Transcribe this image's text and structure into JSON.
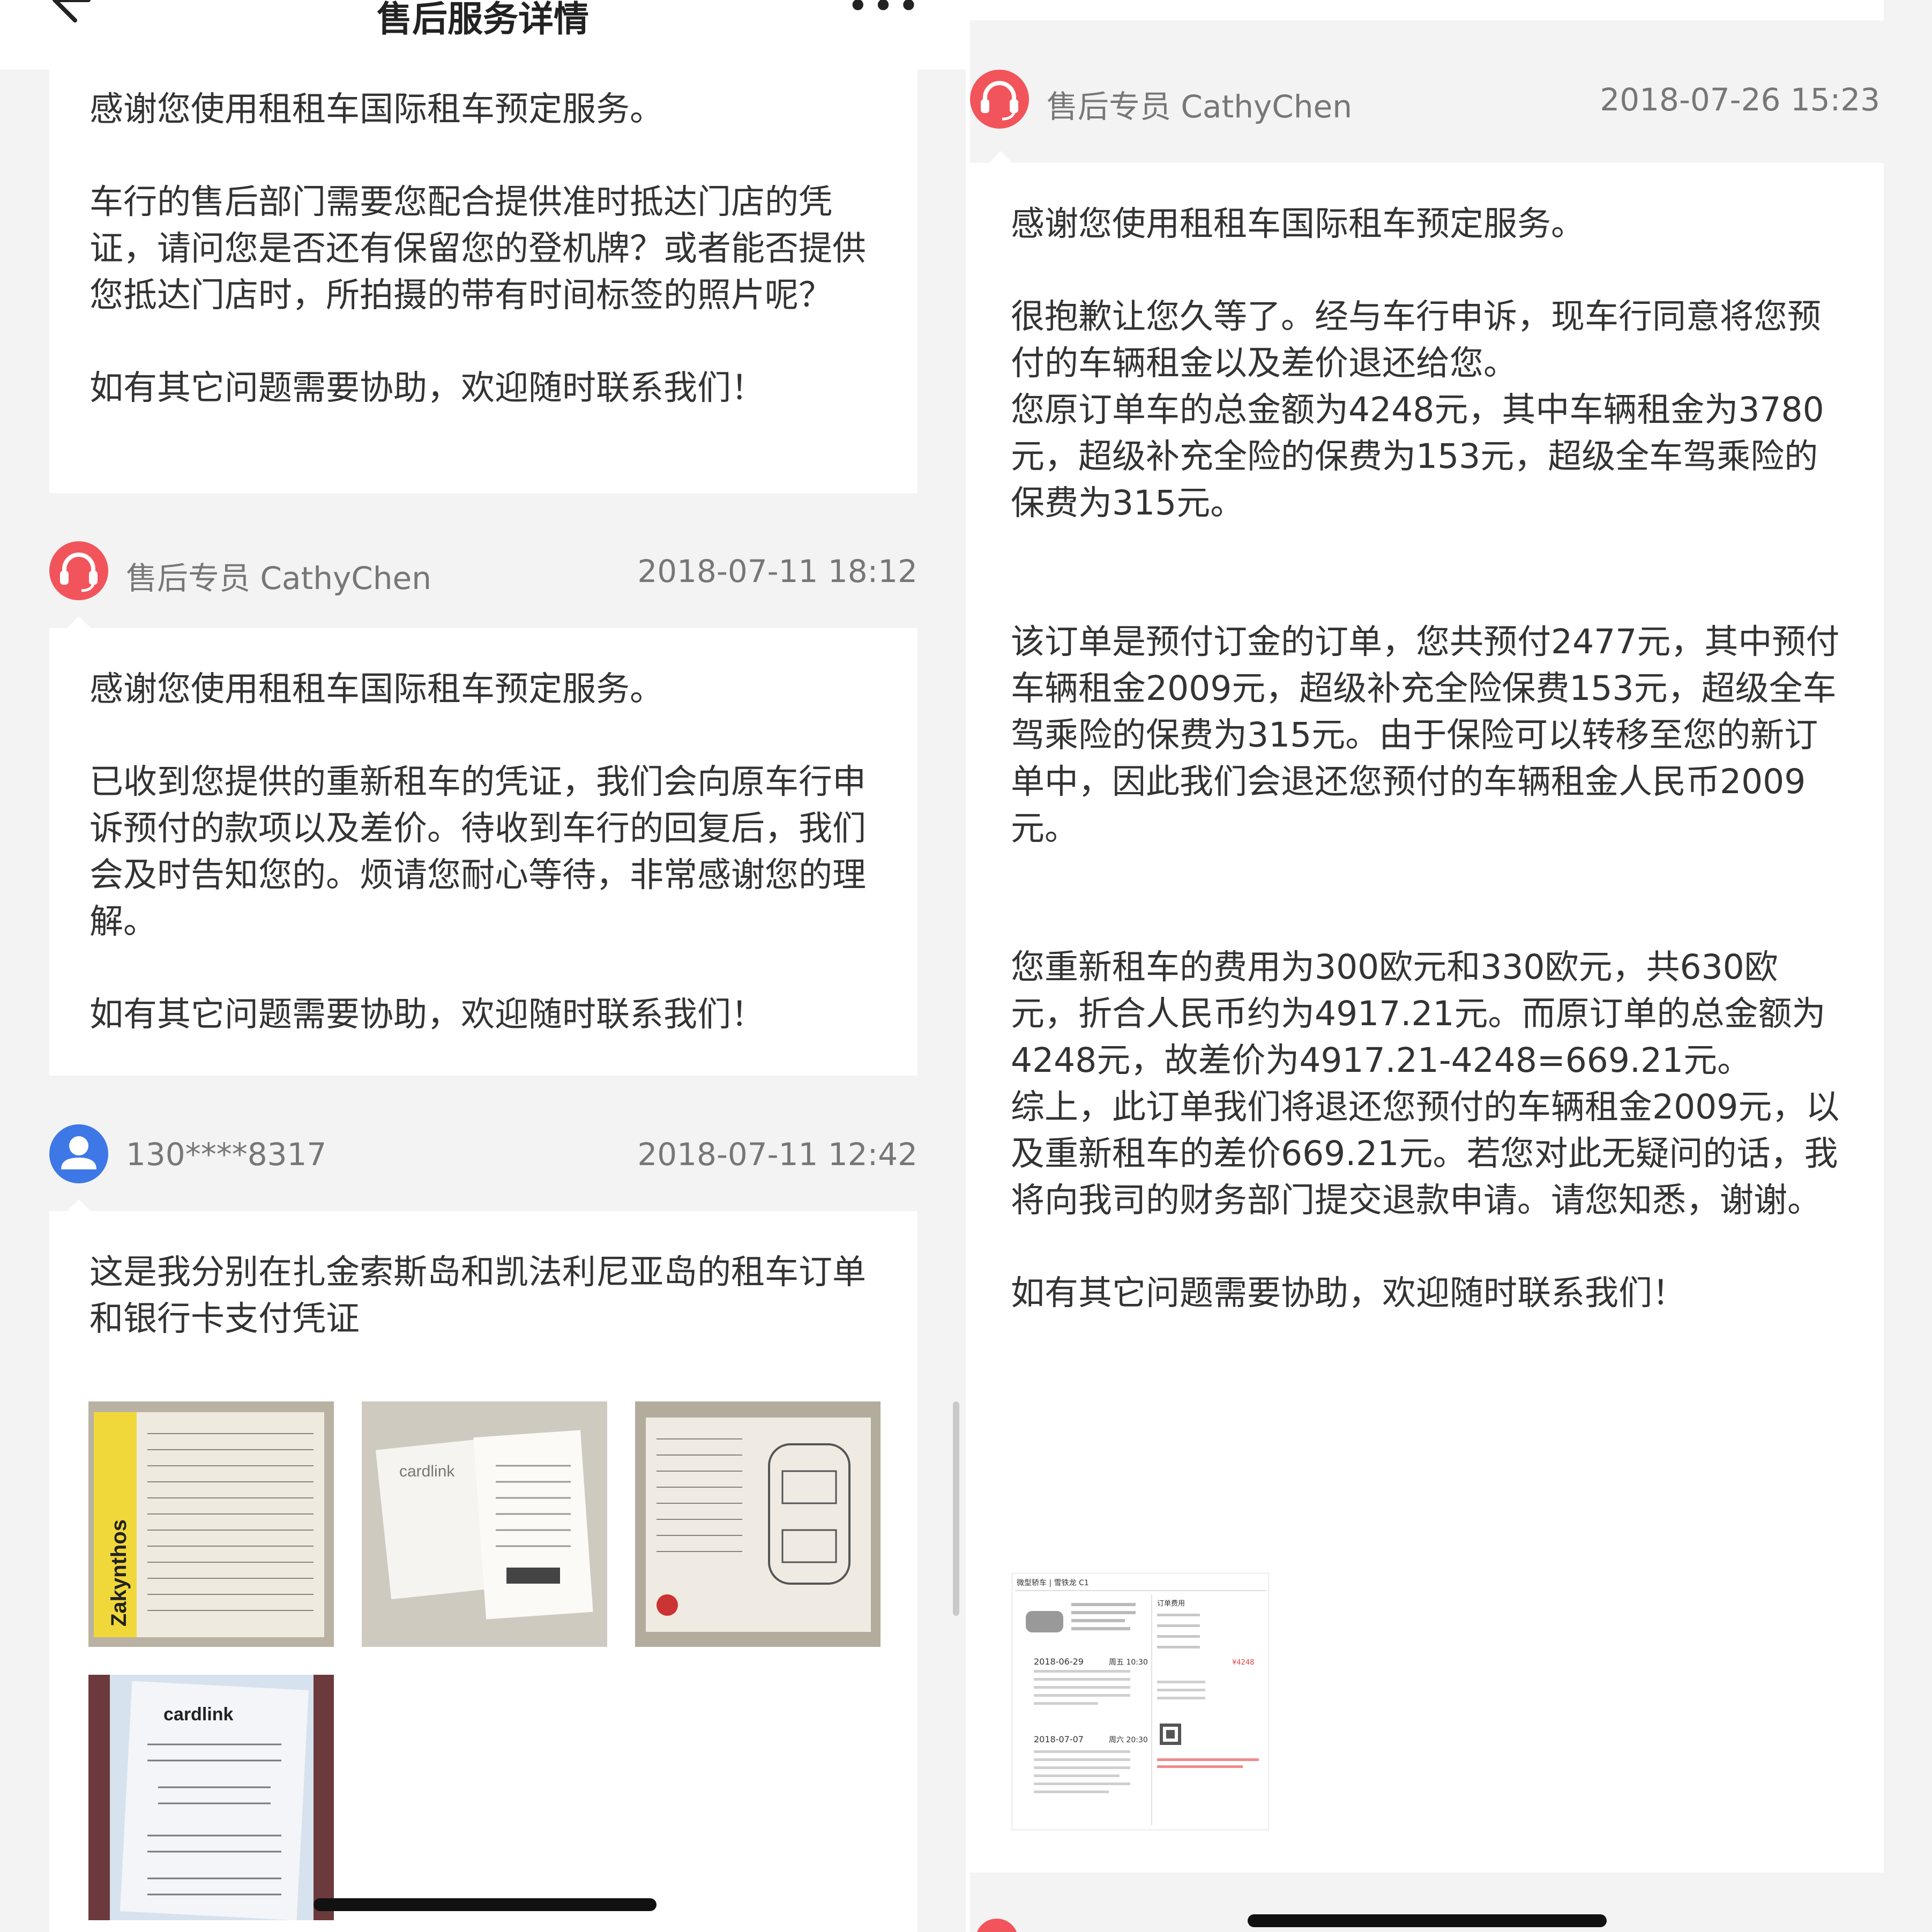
{
  "header": {
    "title": "售后服务详情"
  },
  "left": {
    "card1": {
      "paragraphs": [
        "感谢您使用租租车国际租车预定服务。",
        "车行的售后部门需要您配合提供准时抵达门店的凭证，请问您是否还有保留您的登机牌？或者能否提供您抵达门店时，所拍摄的带有时间标签的照片呢？",
        "如有其它问题需要协助，欢迎随时联系我们！"
      ]
    },
    "msg2": {
      "author": "售后专员 CathyChen",
      "time": "2018-07-11 18:12",
      "paragraphs": [
        "感谢您使用租租车国际租车预定服务。",
        "已收到您提供的重新租车的凭证，我们会向原车行申诉预付的款项以及差价。待收到车行的回复后，我们会及时告知您的。烦请您耐心等待，非常感谢您的理解。",
        "如有其它问题需要协助，欢迎随时联系我们！"
      ]
    },
    "msg3": {
      "author": "130****8317",
      "time": "2018-07-11 12:42",
      "text": "这是我分别在扎金索斯岛和凯法利尼亚岛的租车订单和银行卡支付凭证",
      "photos": [
        {
          "name": "zakynthos-rental-contract-photo",
          "caption": "Zakynthos"
        },
        {
          "name": "cardlink-receipt-photo",
          "caption": "cardlink"
        },
        {
          "name": "car-damage-form-photo",
          "caption": ""
        },
        {
          "name": "cardlink-receipt-closeup-photo",
          "caption": "cardlink"
        }
      ]
    }
  },
  "right": {
    "msg": {
      "author": "售后专员 CathyChen",
      "time": "2018-07-26 15:23",
      "paragraphs": [
        "感谢您使用租租车国际租车预定服务。",
        "很抱歉让您久等了。经与车行申诉，现车行同意将您预付的车辆租金以及差价退还给您。",
        "您原订单车的总金额为4248元，其中车辆租金为3780元，超级补充全险的保费为153元，超级全车驾乘险的保费为315元。",
        "该订单是预付订金的订单，您共预付2477元，其中预付车辆租金2009元，超级补充全险保费153元，超级全车驾乘险的保费为315元。由于保险可以转移至您的新订单中，因此我们会退还您预付的车辆租金人民币2009元。",
        "您重新租车的费用为300欧元和330欧元，共630欧元，折合人民币约为4917.21元。而原订单的总金额为4248元，故差价为4917.21-4248=669.21元。",
        "综上，此订单我们将退还您预付的车辆租金2009元，以及重新租车的差价669.21元。若您对此无疑问的话，我将向我司的财务部门提交退款申请。请您知悉，谢谢。",
        "如有其它问题需要协助，欢迎随时联系我们！"
      ],
      "attachment": {
        "heading": "微型轿车 | 雪铁龙 C1",
        "date1": "2018-06-29",
        "day1": "周五 10:30",
        "date2": "2018-07-07",
        "day2": "周六 20:30",
        "order_label": "订单费用",
        "total": "¥4248"
      }
    }
  },
  "colors": {
    "agent": "#f2545b",
    "user": "#3e77e6",
    "background": "#f3f3f3"
  }
}
